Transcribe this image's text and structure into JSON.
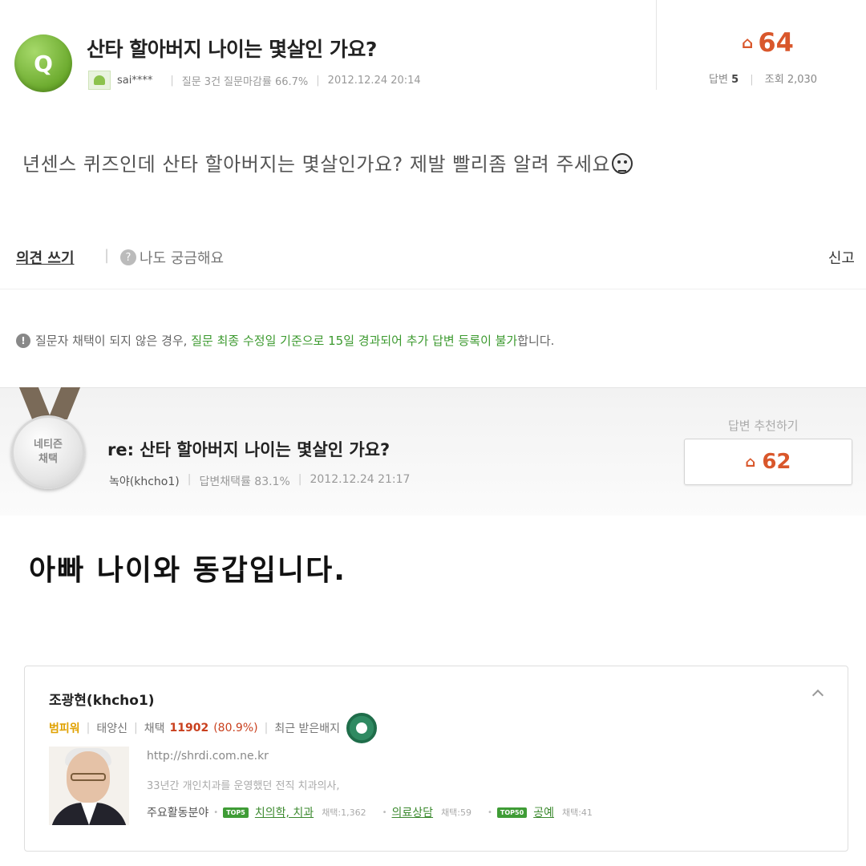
{
  "question": {
    "badge": "Q",
    "title": "산타 할아버지 나이는 몇살인 가요?",
    "author": "sai****",
    "question_count": "질문 3건",
    "close_rate": "질문마감률 66.7%",
    "datetime": "2012.12.24 20:14",
    "likes": "64",
    "answers_label": "답변",
    "answers_count": "5",
    "views_label": "조회",
    "views_count": "2,030",
    "body": "년센스 퀴즈인데 산타 할아버지는 몇살인가요? 제발 빨리좀 알려 주세요",
    "write_opinion": "의견 쓰기",
    "curious_label": "나도 궁금해요",
    "report": "신고"
  },
  "notice": {
    "prefix": "질문자 채택이 되지 않은 경우,",
    "highlight": "질문 최종 수정일 기준으로 15일 경과되어 추가 답변 등록이 불가",
    "suffix": "합니다."
  },
  "answer": {
    "medal_line1": "네티즌",
    "medal_line2": "채택",
    "title": "re: 산타 할아버지 나이는 몇살인 가요?",
    "author": "녹야(khcho1)",
    "adopt_rate": "답변채택률 83.1%",
    "datetime": "2012.12.24 21:17",
    "recommend_label": "답변 추천하기",
    "recommend_count": "62",
    "body": "아빠 나이와 동갑입니다."
  },
  "profile": {
    "name": "조광현(khcho1)",
    "rank": "범피워",
    "grade": "태양신",
    "adopt_label": "채택",
    "adopt_count": "11902",
    "adopt_percent": "(80.9%)",
    "recent_badge": "최근 받은배지",
    "url": "http://shrdi.com.ne.kr",
    "desc": "33년간 개인치과를 운영했던 전직 치과의사,",
    "areas_label": "주요활동분야",
    "areas": [
      {
        "tag": "TOP5",
        "name": "치의학, 치과",
        "count": "채택:1,362"
      },
      {
        "tag": "",
        "name": "의료상담",
        "count": "채택:59"
      },
      {
        "tag": "TOP50",
        "name": "공예",
        "count": "채택:41"
      }
    ]
  },
  "colors": {
    "accent_orange": "#d9572b",
    "accent_green": "#3c9a2f",
    "q_badge_green": "#6aa92c"
  }
}
